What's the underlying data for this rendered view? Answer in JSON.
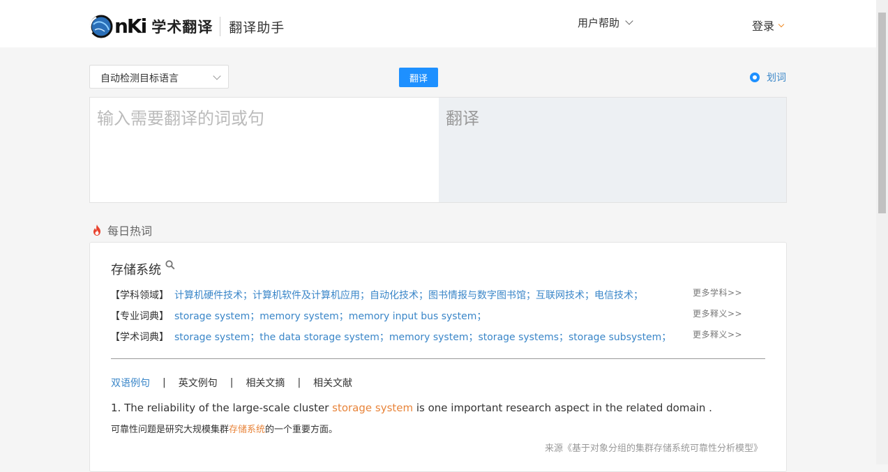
{
  "header": {
    "logo_nki": "nKi",
    "brand": "学术翻译",
    "subtitle": "翻译助手",
    "help_label": "用户帮助",
    "login_label": "登录"
  },
  "controls": {
    "language_select": "自动检测目标语言",
    "translate_button": "翻译",
    "huaci_label": "划词"
  },
  "translator": {
    "input_placeholder": "输入需要翻译的词或句",
    "output_placeholder": "翻译"
  },
  "hot": {
    "section_title": "每日热词",
    "word": "存储系统",
    "rows": [
      {
        "label": "【学科领域】",
        "items": "计算机硬件技术；计算机软件及计算机应用；自动化技术；图书情报与数字图书馆；互联网技术；电信技术；",
        "more": "更多学科>>"
      },
      {
        "label": "【专业词典】",
        "items": "storage system；memory system；memory input bus system；",
        "more": "更多释义>>"
      },
      {
        "label": "【学术词典】",
        "items": "storage system；the data storage system；memory system；storage systems；storage subsystem；",
        "more": "更多释义>>"
      }
    ],
    "tabs": [
      "双语例句",
      "英文例句",
      "相关文摘",
      "相关文献"
    ],
    "tab_separator": "|",
    "example": {
      "prefix": "1. The reliability of the large-scale cluster ",
      "highlight": "storage system",
      "suffix": " is one important research aspect in the related domain .",
      "zh_prefix": "可靠性问题是研究大规模集群",
      "zh_highlight": "存储系统",
      "zh_suffix": "的一个重要方面。",
      "source": "来源《基于对象分组的集群存储系统可靠性分析模型》"
    }
  },
  "colors": {
    "accent_blue": "#1e90ff",
    "link_blue": "#3a86c8",
    "highlight_orange": "#e8843a"
  }
}
